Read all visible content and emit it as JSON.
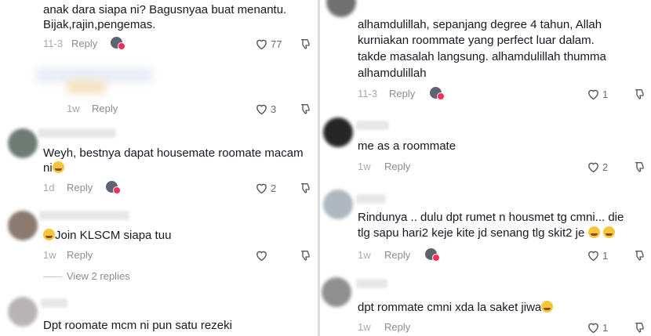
{
  "left": {
    "comments": [
      {
        "text": [
          "anak dara siapa ni? Bagusnyaa buat menantu.",
          "Bijak,rajin,pengemas."
        ],
        "date": "11-3",
        "reply": "Reply",
        "likes": "77",
        "creator_liked": true
      },
      {
        "text": [],
        "date": "1w",
        "reply": "Reply",
        "likes": "3",
        "creator_liked": false
      },
      {
        "text": [
          "Weyh, bestnya dapat housemate roomate macam",
          "ni"
        ],
        "emoji": "crying-laughing",
        "date": "1d",
        "reply": "Reply",
        "likes": "2",
        "creator_liked": true
      },
      {
        "text": [
          "Join KLSCM siapa tuu"
        ],
        "emoji": "star-struck",
        "date": "1w",
        "reply": "Reply",
        "likes": "",
        "creator_liked": false
      },
      {
        "text": [
          "Dpt roomate mcm ni pun satu rezeki"
        ],
        "date": "",
        "reply": "",
        "likes": "",
        "creator_liked": false
      }
    ],
    "view_replies": "View 2 replies"
  },
  "right": {
    "comments": [
      {
        "text": [
          "alhamdulillah, sepanjang degree 4 tahun, Allah",
          "kurniakan roommate yang perfect luar dalam.",
          "takde masalah langsung. alhamdulillah thumma",
          "alhamdulillah"
        ],
        "date": "11-3",
        "reply": "Reply",
        "likes": "1",
        "creator_liked": true
      },
      {
        "text": [
          "me as a roommate"
        ],
        "date": "1w",
        "reply": "Reply",
        "likes": "2",
        "creator_liked": false
      },
      {
        "text": [
          "Rindunya .. dulu dpt rumet n housmet tg cmni... die",
          "tlg sapu hari2 keje kite jd senang tlg skit2 je"
        ],
        "emoji": "zany-face",
        "date": "1w",
        "reply": "Reply",
        "likes": "1",
        "creator_liked": true
      },
      {
        "text": [
          "dpt rommate cmni xda la saket jiwa"
        ],
        "emoji": "crying-laughing",
        "date": "1w",
        "reply": "Reply",
        "likes": "1",
        "creator_liked": false
      }
    ]
  },
  "icons": {
    "like": "heart-outline-icon",
    "dislike": "thumbs-down-icon",
    "creator": "creator-liked-avatar-icon"
  },
  "colors": {
    "text": "#161823",
    "meta": "#8a8b91",
    "heart_badge": "#fe2c55"
  }
}
